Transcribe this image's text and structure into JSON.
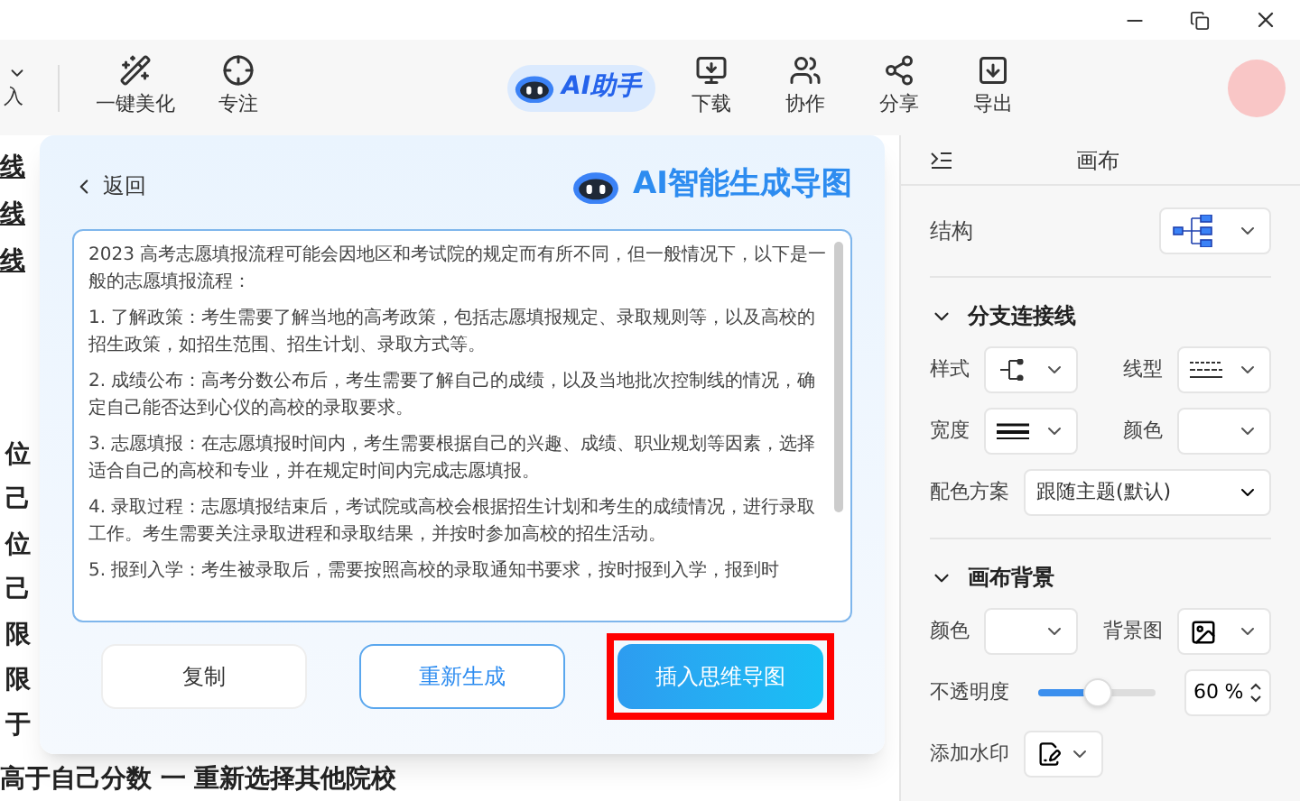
{
  "toolbar": {
    "fragment": "入",
    "left_items": [
      {
        "label": "一键美化",
        "kind": "wand"
      },
      {
        "label": "专注",
        "kind": "target"
      }
    ],
    "ai_button": "AI助手",
    "right_items": [
      {
        "label": "下载",
        "kind": "download"
      },
      {
        "label": "协作",
        "kind": "people"
      },
      {
        "label": "分享",
        "kind": "share"
      },
      {
        "label": "导出",
        "kind": "export"
      }
    ]
  },
  "background_text": [
    "线",
    "线",
    "线",
    "位",
    "己",
    "位",
    "己",
    "限",
    "限",
    "于",
    "高于自己分数 一 重新选择其他院校"
  ],
  "dialog": {
    "back": "返回",
    "title": "AI智能生成导图",
    "paragraphs": [
      "2023 高考志愿填报流程可能会因地区和考试院的规定而有所不同，但一般情况下，以下是一般的志愿填报流程：",
      "1. 了解政策：考生需要了解当地的高考政策，包括志愿填报规定、录取规则等，以及高校的招生政策，如招生范围、招生计划、录取方式等。",
      "2. 成绩公布：高考分数公布后，考生需要了解自己的成绩，以及当地批次控制线的情况，确定自己能否达到心仪的高校的录取要求。",
      "3. 志愿填报：在志愿填报时间内，考生需要根据自己的兴趣、成绩、职业规划等因素，选择适合自己的高校和专业，并在规定时间内完成志愿填报。",
      "4. 录取过程：志愿填报结束后，考试院或高校会根据招生计划和考生的成绩情况，进行录取工作。考生需要关注录取进程和录取结果，并按时参加高校的招生活动。",
      "5. 报到入学：考生被录取后，需要按照高校的录取通知书要求，按时报到入学，报到时"
    ],
    "buttons": [
      {
        "label": "复制",
        "kind": "plain",
        "highlighted": false
      },
      {
        "label": "重新生成",
        "kind": "outline",
        "highlighted": false
      },
      {
        "label": "插入思维导图",
        "kind": "primary",
        "highlighted": true
      }
    ]
  },
  "panel": {
    "title": "画布",
    "structure_label": "结构",
    "branch": {
      "title": "分支连接线",
      "expanded": true,
      "style_label": "样式",
      "line_type_label": "线型",
      "width_label": "宽度",
      "color_label": "颜色",
      "scheme_label": "配色方案",
      "scheme_value": "跟随主题(默认)"
    },
    "canvas": {
      "title": "画布背景",
      "expanded": true,
      "color_label": "颜色",
      "image_label": "背景图",
      "opacity_label": "不透明度",
      "opacity": {
        "level": 0.5
      },
      "opacity_value": "60",
      "opacity_unit": "%",
      "watermark_label": "添加水印"
    }
  }
}
